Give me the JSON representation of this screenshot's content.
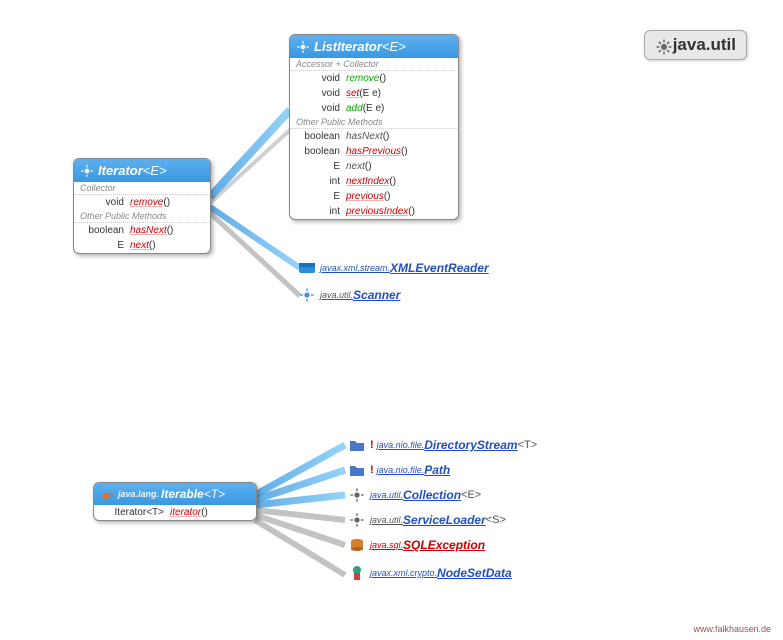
{
  "package_badge": {
    "label": "java.util"
  },
  "iterator": {
    "title": "Iterator",
    "generic": "<E>",
    "section1": "Collector",
    "m_remove_ret": "void",
    "m_remove": "remove",
    "m_remove_p": "()",
    "section2": "Other Public Methods",
    "m_hasNext_ret": "boolean",
    "m_hasNext": "hasNext",
    "m_hasNext_p": "()",
    "m_next_ret": "E",
    "m_next": "next",
    "m_next_p": "()"
  },
  "listiterator": {
    "title": "ListIterator",
    "generic": "<E>",
    "section1": "Accessor + Collector",
    "m_remove_ret": "void",
    "m_remove": "remove",
    "m_remove_p": "()",
    "m_set_ret": "void",
    "m_set": "set",
    "m_set_p": "(E e)",
    "m_add_ret": "void",
    "m_add": "add",
    "m_add_p": "(E e)",
    "section2": "Other Public Methods",
    "m_hasNext_ret": "boolean",
    "m_hasNext": "hasNext",
    "m_hasNext_p": "()",
    "m_hasPrevious_ret": "boolean",
    "m_hasPrevious": "hasPrevious",
    "m_hasPrevious_p": "()",
    "m_next_ret": "E",
    "m_next": "next",
    "m_next_p": "()",
    "m_nextIndex_ret": "int",
    "m_nextIndex": "nextIndex",
    "m_nextIndex_p": "()",
    "m_previous_ret": "E",
    "m_previous": "previous",
    "m_previous_p": "()",
    "m_previousIndex_ret": "int",
    "m_previousIndex": "previousIndex",
    "m_previousIndex_p": "()"
  },
  "iterable": {
    "pkg": "java.lang.",
    "title": "Iterable",
    "generic": "<T>",
    "m_iterator_ret": "Iterator<T>",
    "m_iterator": "iterator",
    "m_iterator_p": "()"
  },
  "related_top": {
    "r1_pkg": "javax.xml.stream.",
    "r1_name": "XMLEventReader",
    "r2_pkg": "java.util.",
    "r2_name": "Scanner"
  },
  "related_bottom": {
    "r1_pkg": "java.nio.file.",
    "r1_name": "DirectoryStream",
    "r1_gen": "<T>",
    "r2_pkg": "java.nio.file.",
    "r2_name": "Path",
    "r3_pkg": "java.util.",
    "r3_name": "Collection",
    "r3_gen": "<E>",
    "r4_pkg": "java.util.",
    "r4_name": "ServiceLoader",
    "r4_gen": "<S>",
    "r5_pkg": "java.sql.",
    "r5_name": "SQLException",
    "r6_pkg": "javax.xml.crypto.",
    "r6_name": "NodeSetData"
  },
  "icons": {
    "warn": "!"
  },
  "footer": "www.falkhausen.de"
}
